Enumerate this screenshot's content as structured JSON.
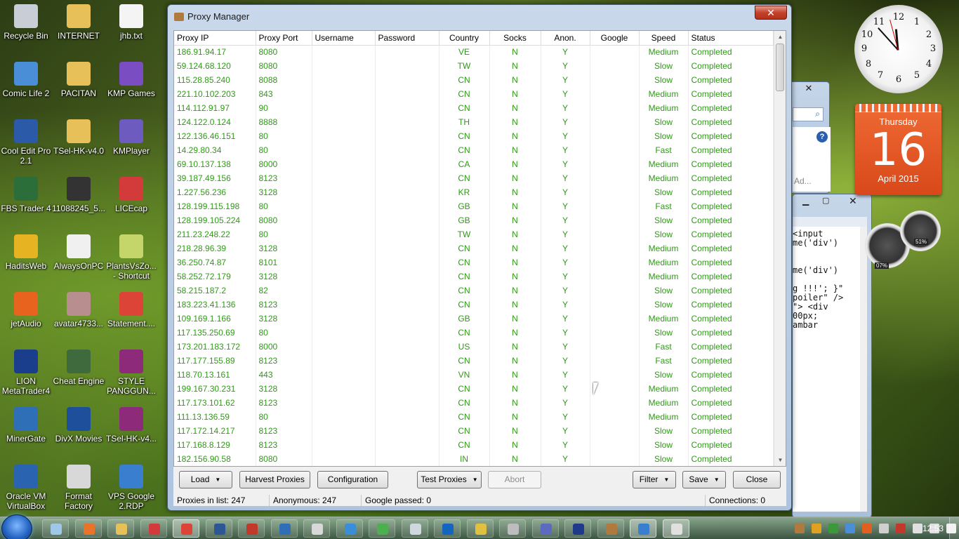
{
  "desktop_icons": [
    {
      "label": "Recycle Bin",
      "color": "#c9ced6"
    },
    {
      "label": "INTERNET",
      "color": "#e8c05a"
    },
    {
      "label": "jhb.txt",
      "color": "#f4f4f4"
    },
    {
      "label": "Comic Life 2",
      "color": "#4a8ed8"
    },
    {
      "label": "PACITAN",
      "color": "#e8c05a"
    },
    {
      "label": "KMP Games",
      "color": "#7a4ec2"
    },
    {
      "label": "Cool Edit Pro 2.1",
      "color": "#2a5aa8"
    },
    {
      "label": "TSel-HK-v4.0",
      "color": "#e8c05a"
    },
    {
      "label": "KMPlayer",
      "color": "#6d5bc0"
    },
    {
      "label": "FBS Trader 4",
      "color": "#2c6e3a"
    },
    {
      "label": "11088245_5...",
      "color": "#333333"
    },
    {
      "label": "LICEcap",
      "color": "#d33a3a"
    },
    {
      "label": "HaditsWeb",
      "color": "#e6b422"
    },
    {
      "label": "AlwaysOnPC",
      "color": "#f0f0f0"
    },
    {
      "label": "PlantsVsZo... - Shortcut",
      "color": "#c4d66a"
    },
    {
      "label": "jetAudio",
      "color": "#e8641e"
    },
    {
      "label": "avatar4733...",
      "color": "#b88e8e"
    },
    {
      "label": "Statement....",
      "color": "#db4437"
    },
    {
      "label": "LION MetaTrader4",
      "color": "#1a3e8c"
    },
    {
      "label": "Cheat Engine",
      "color": "#3e6a3e"
    },
    {
      "label": "STYLE PANGGUN...",
      "color": "#8e2a7a"
    },
    {
      "label": "MinerGate",
      "color": "#2e6fb8"
    },
    {
      "label": "DivX Movies",
      "color": "#1e4f9a"
    },
    {
      "label": "TSel-HK-v4...",
      "color": "#8e2a7a"
    },
    {
      "label": "Oracle VM VirtualBox",
      "color": "#2a64b0"
    },
    {
      "label": "Format Factory",
      "color": "#d8d8d8"
    },
    {
      "label": "VPS Google 2.RDP",
      "color": "#3a7ed0"
    }
  ],
  "window": {
    "title": "Proxy Manager",
    "close_glyph": "✕",
    "columns": [
      "Proxy IP",
      "Proxy Port",
      "Username",
      "Password",
      "Country",
      "Socks",
      "Anon.",
      "Google",
      "Speed",
      "Status"
    ],
    "rows": [
      [
        "186.91.94.17",
        "8080",
        "",
        "",
        "VE",
        "N",
        "Y",
        "",
        "Medium",
        "Completed"
      ],
      [
        "59.124.68.120",
        "8080",
        "",
        "",
        "TW",
        "N",
        "Y",
        "",
        "Slow",
        "Completed"
      ],
      [
        "115.28.85.240",
        "8088",
        "",
        "",
        "CN",
        "N",
        "Y",
        "",
        "Slow",
        "Completed"
      ],
      [
        "221.10.102.203",
        "843",
        "",
        "",
        "CN",
        "N",
        "Y",
        "",
        "Medium",
        "Completed"
      ],
      [
        "114.112.91.97",
        "90",
        "",
        "",
        "CN",
        "N",
        "Y",
        "",
        "Medium",
        "Completed"
      ],
      [
        "124.122.0.124",
        "8888",
        "",
        "",
        "TH",
        "N",
        "Y",
        "",
        "Slow",
        "Completed"
      ],
      [
        "122.136.46.151",
        "80",
        "",
        "",
        "CN",
        "N",
        "Y",
        "",
        "Slow",
        "Completed"
      ],
      [
        "14.29.80.34",
        "80",
        "",
        "",
        "CN",
        "N",
        "Y",
        "",
        "Fast",
        "Completed"
      ],
      [
        "69.10.137.138",
        "8000",
        "",
        "",
        "CA",
        "N",
        "Y",
        "",
        "Medium",
        "Completed"
      ],
      [
        "39.187.49.156",
        "8123",
        "",
        "",
        "CN",
        "N",
        "Y",
        "",
        "Medium",
        "Completed"
      ],
      [
        "1.227.56.236",
        "3128",
        "",
        "",
        "KR",
        "N",
        "Y",
        "",
        "Slow",
        "Completed"
      ],
      [
        "128.199.115.198",
        "80",
        "",
        "",
        "GB",
        "N",
        "Y",
        "",
        "Fast",
        "Completed"
      ],
      [
        "128.199.105.224",
        "8080",
        "",
        "",
        "GB",
        "N",
        "Y",
        "",
        "Slow",
        "Completed"
      ],
      [
        "211.23.248.22",
        "80",
        "",
        "",
        "TW",
        "N",
        "Y",
        "",
        "Slow",
        "Completed"
      ],
      [
        "218.28.96.39",
        "3128",
        "",
        "",
        "CN",
        "N",
        "Y",
        "",
        "Medium",
        "Completed"
      ],
      [
        "36.250.74.87",
        "8101",
        "",
        "",
        "CN",
        "N",
        "Y",
        "",
        "Medium",
        "Completed"
      ],
      [
        "58.252.72.179",
        "3128",
        "",
        "",
        "CN",
        "N",
        "Y",
        "",
        "Medium",
        "Completed"
      ],
      [
        "58.215.187.2",
        "82",
        "",
        "",
        "CN",
        "N",
        "Y",
        "",
        "Slow",
        "Completed"
      ],
      [
        "183.223.41.136",
        "8123",
        "",
        "",
        "CN",
        "N",
        "Y",
        "",
        "Slow",
        "Completed"
      ],
      [
        "109.169.1.166",
        "3128",
        "",
        "",
        "GB",
        "N",
        "Y",
        "",
        "Medium",
        "Completed"
      ],
      [
        "117.135.250.69",
        "80",
        "",
        "",
        "CN",
        "N",
        "Y",
        "",
        "Slow",
        "Completed"
      ],
      [
        "173.201.183.172",
        "8000",
        "",
        "",
        "US",
        "N",
        "Y",
        "",
        "Fast",
        "Completed"
      ],
      [
        "117.177.155.89",
        "8123",
        "",
        "",
        "CN",
        "N",
        "Y",
        "",
        "Fast",
        "Completed"
      ],
      [
        "118.70.13.161",
        "443",
        "",
        "",
        "VN",
        "N",
        "Y",
        "",
        "Slow",
        "Completed"
      ],
      [
        "199.167.30.231",
        "3128",
        "",
        "",
        "CN",
        "N",
        "Y",
        "",
        "Medium",
        "Completed"
      ],
      [
        "117.173.101.62",
        "8123",
        "",
        "",
        "CN",
        "N",
        "Y",
        "",
        "Medium",
        "Completed"
      ],
      [
        "111.13.136.59",
        "80",
        "",
        "",
        "CN",
        "N",
        "Y",
        "",
        "Medium",
        "Completed"
      ],
      [
        "117.172.14.217",
        "8123",
        "",
        "",
        "CN",
        "N",
        "Y",
        "",
        "Slow",
        "Completed"
      ],
      [
        "117.168.8.129",
        "8123",
        "",
        "",
        "CN",
        "N",
        "Y",
        "",
        "Slow",
        "Completed"
      ],
      [
        "182.156.90.58",
        "8080",
        "",
        "",
        "IN",
        "N",
        "Y",
        "",
        "Slow",
        "Completed"
      ]
    ],
    "buttons": {
      "load": "Load",
      "harvest": "Harvest Proxies",
      "configuration": "Configuration",
      "test": "Test Proxies",
      "abort": "Abort",
      "filter": "Filter",
      "save": "Save",
      "close": "Close"
    },
    "status": {
      "proxies_label": "Proxies in list:",
      "proxies_value": "247",
      "anon_label": "Anonymous:",
      "anon_value": "247",
      "google_label": "Google passed:",
      "google_value": "0",
      "conn_label": "Connections:",
      "conn_value": "0"
    }
  },
  "bg_editor_lines": [
    "<input",
    "me('div')",
    "me('div')",
    "g !!!'; }\"",
    "poiler\" />",
    "\"> <div",
    "00px;",
    "ambar"
  ],
  "bg_search_text": "Ad...",
  "calendar": {
    "day": "Thursday",
    "date": "16",
    "month": "April 2015"
  },
  "gauges": {
    "cpu": "07%",
    "mem": "51%"
  },
  "taskbar": {
    "time": "12:53"
  },
  "colors": {
    "text_green": "#2f9a17",
    "calendar_orange": "#e35a25"
  }
}
